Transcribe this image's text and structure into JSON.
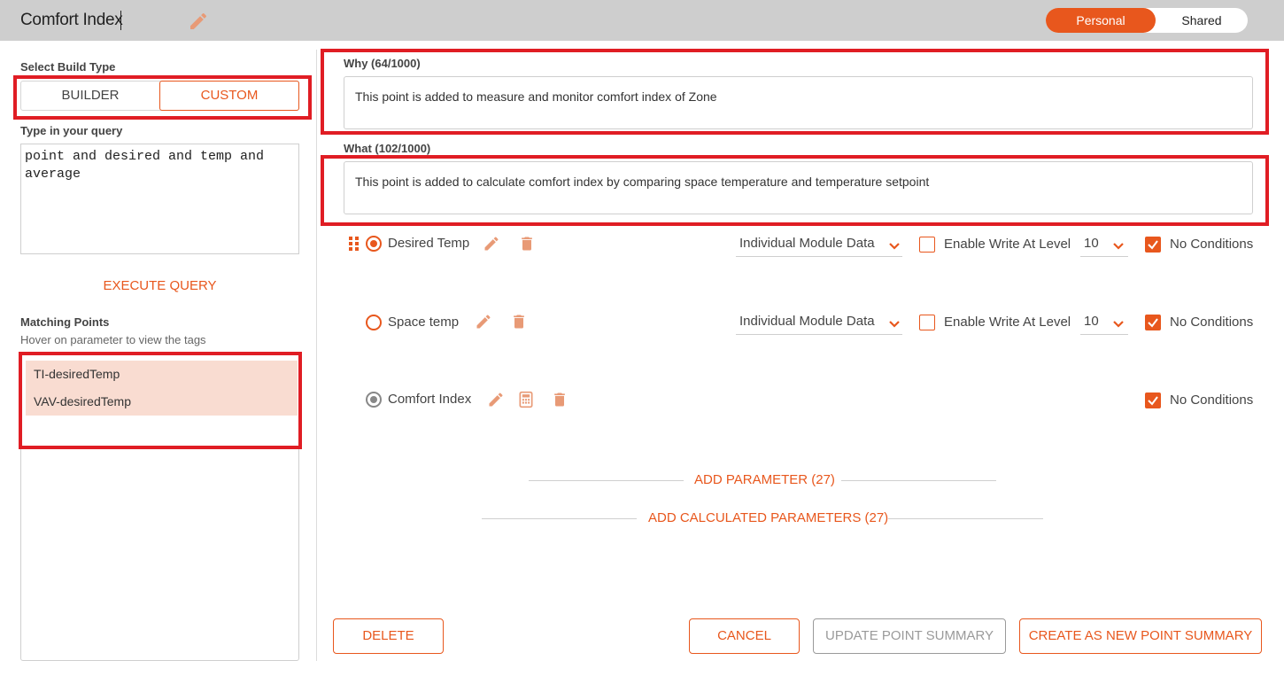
{
  "header": {
    "title": "Comfort Index",
    "edit_icon": "pencil-icon",
    "toggle": {
      "active": "Personal",
      "inactive": "Shared"
    },
    "accent_color": "#e8571d",
    "bar_color": "#cecece"
  },
  "left": {
    "build_type_label": "Select Build Type",
    "build_options": [
      "BUILDER",
      "CUSTOM"
    ],
    "selected_build": "CUSTOM",
    "query_label": "Type in your query",
    "query_value": "point and desired and temp and\naverage",
    "execute_label": "EXECUTE QUERY",
    "matching_label": "Matching Points",
    "matching_hint": "Hover on parameter to view the tags",
    "matching_points": [
      "TI-desiredTemp",
      "VAV-desiredTemp"
    ]
  },
  "main": {
    "why_label": "Why (64/1000)",
    "why_value": "This point is added to measure and monitor comfort index of Zone",
    "what_label": "What (102/1000)",
    "what_value": "This point is added to calculate comfort index by comparing space temperature and temperature setpoint",
    "params": [
      {
        "name": "Desired Temp",
        "source": "Individual Module Data",
        "write_label": "Enable Write At Level",
        "level": "10",
        "conditions_label": "No Conditions",
        "selected": true
      },
      {
        "name": "Space temp",
        "source": "Individual Module Data",
        "write_label": "Enable Write At Level",
        "level": "10",
        "conditions_label": "No Conditions",
        "selected": false
      },
      {
        "name": "Comfort Index",
        "conditions_label": "No Conditions",
        "calculated": true
      }
    ],
    "add_parameter": "ADD PARAMETER (27)",
    "add_calculated": "ADD CALCULATED PARAMETERS (27)"
  },
  "footer": {
    "delete": "DELETE",
    "cancel": "CANCEL",
    "update": "UPDATE POINT SUMMARY",
    "create": "CREATE AS NEW POINT SUMMARY"
  }
}
